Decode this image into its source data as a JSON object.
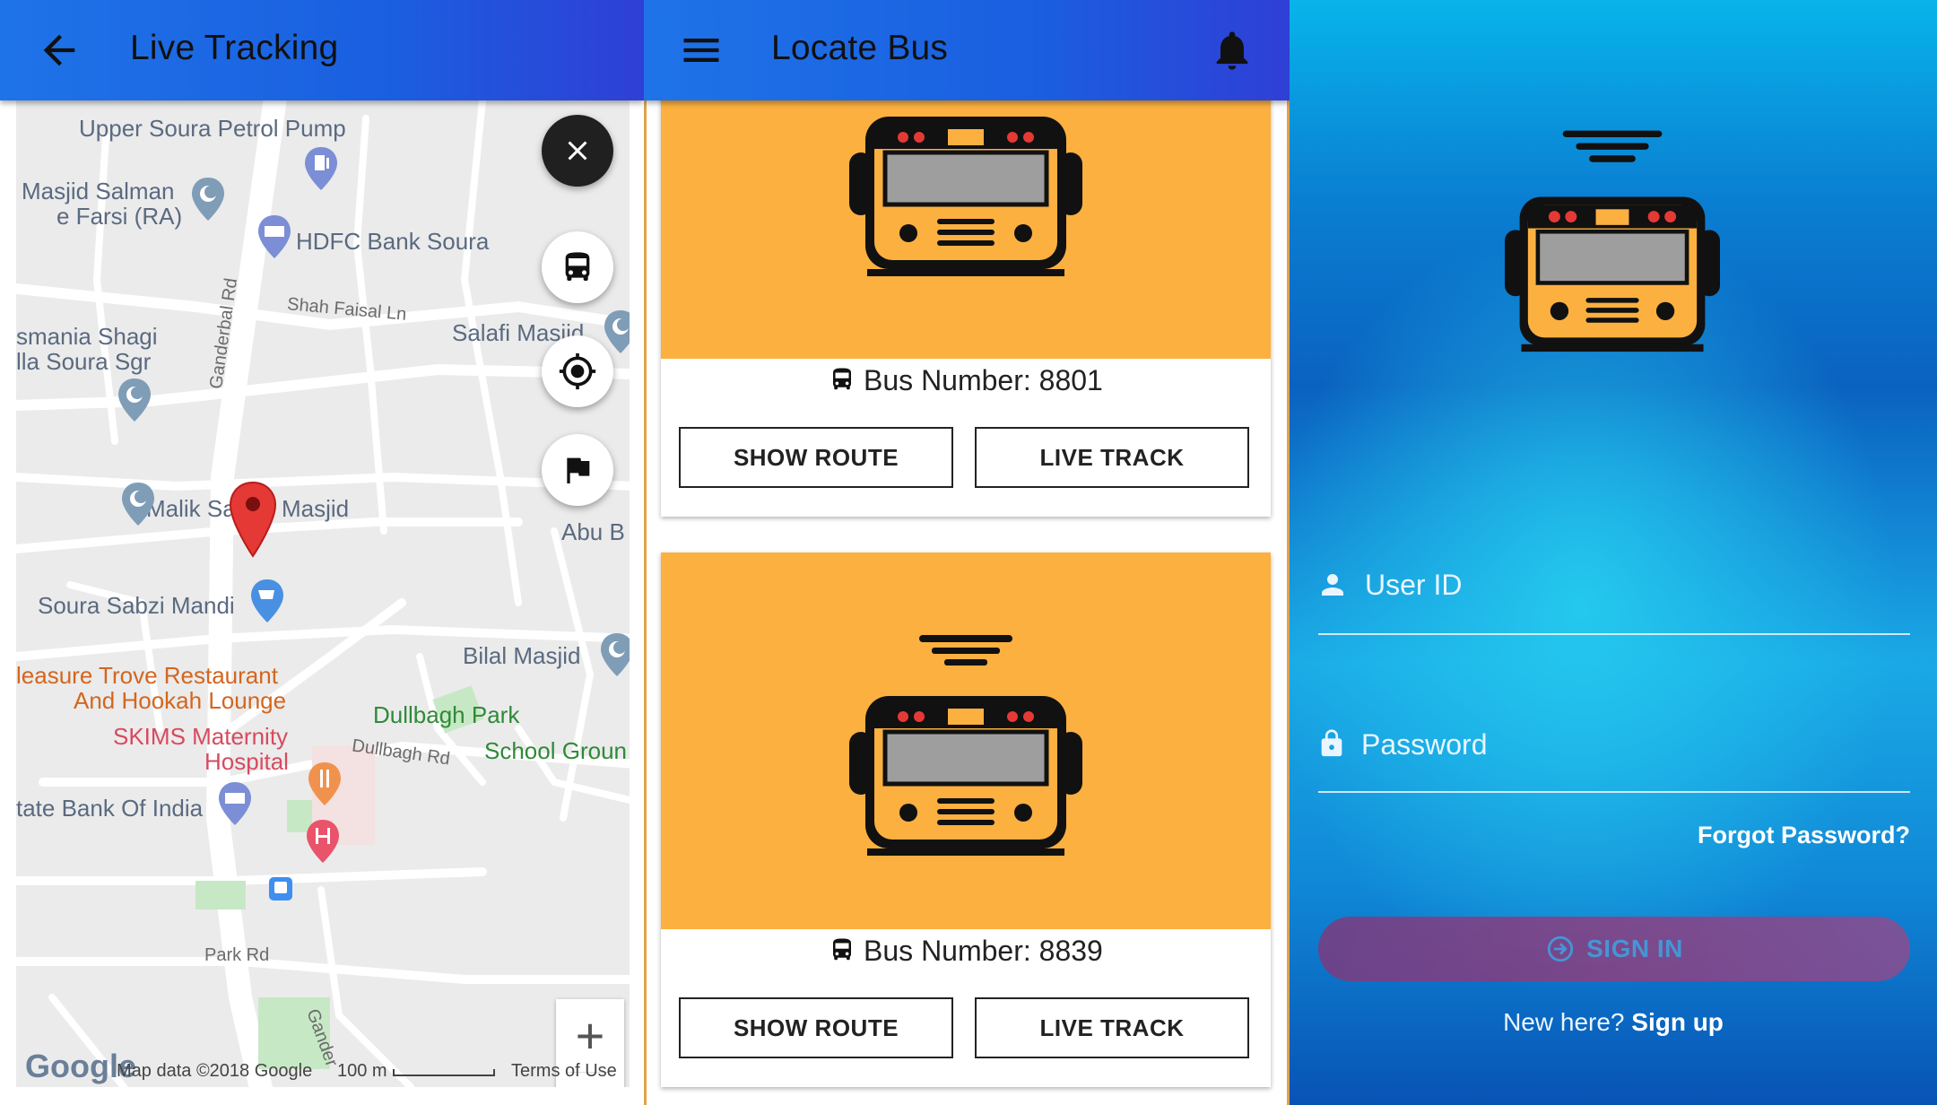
{
  "live_tracking": {
    "title": "Live Tracking",
    "map_labels": {
      "petrol_pump": "Upper Soura Petrol Pump",
      "masjid_salman_1": "Masjid Salman",
      "masjid_salman_2": "e Farsi (RA)",
      "hdfc": "HDFC Bank Soura",
      "shah_faisal": "Shah Faisal Ln",
      "salafi": "Salafi Masjid",
      "osmania_1": "smania Shagi",
      "osmania_2": "lla Soura Sgr",
      "ganderbal": "Ganderbal Rd",
      "malik_sahib": "Malik Sa",
      "masjid": "Masjid",
      "abu_b": "Abu B",
      "sabzi_mandi": "Soura Sabzi Mandi",
      "bilal": "Bilal Masjid",
      "pleasure_1": "leasure Trove Restaurant",
      "pleasure_2": "And Hookah Lounge",
      "dullbagh_park": "Dullbagh Park",
      "skims_1": "SKIMS Maternity",
      "skims_2": "Hospital",
      "dullbagh_rd": "Dullbagh Rd",
      "school_ground": "School Groun",
      "state_bank": "tate Bank Of India",
      "park_rd": "Park Rd",
      "gander": "Gander"
    },
    "footer": {
      "logo": "Google",
      "map_data": "Map data ©2018 Google",
      "scale": "100 m",
      "terms": "Terms of Use"
    },
    "zoom": {
      "plus": "+",
      "minus": "−"
    }
  },
  "locate_bus": {
    "title": "Locate Bus",
    "cards": [
      {
        "bus_label": "Bus Number: 8801",
        "show_route": "SHOW ROUTE",
        "live_track": "LIVE TRACK"
      },
      {
        "bus_label": "Bus Number: 8839",
        "show_route": "SHOW ROUTE",
        "live_track": "LIVE TRACK"
      }
    ]
  },
  "login": {
    "user_id": "User ID",
    "password": "Password",
    "forgot": "Forgot Password?",
    "sign_in": "SIGN IN",
    "new_here": "New here?",
    "sign_up": "Sign up"
  },
  "icons": {
    "back": "arrow-left-icon",
    "menu": "hamburger-menu-icon",
    "bell": "bell-icon",
    "close": "close-icon",
    "bus": "bus-icon",
    "locate": "my-location-icon",
    "flag": "flag-icon",
    "user": "person-icon",
    "lock": "lock-icon",
    "login": "login-icon"
  },
  "colors": {
    "app_bar": "#1f73e8",
    "card_art": "#fbb040",
    "sign_in_button": "#8e3f80",
    "map_marker": "#e53935"
  }
}
